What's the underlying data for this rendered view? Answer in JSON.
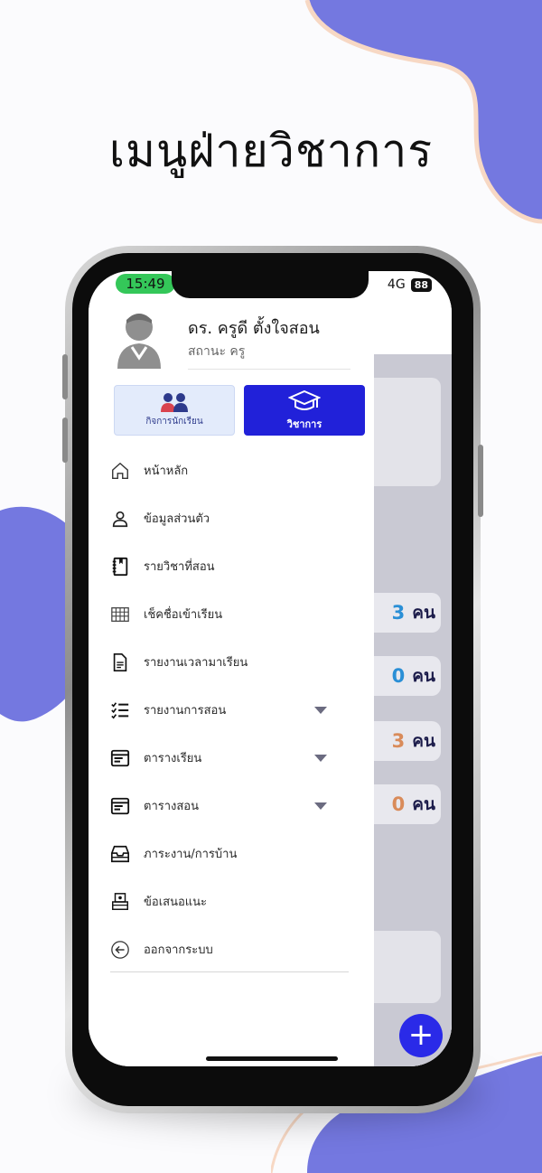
{
  "heading": "เมนูฝ่ายวิชาการ",
  "colors": {
    "accent_blob": "#7478e0",
    "primary": "#2121d9",
    "status_green": "#34c759"
  },
  "status_bar": {
    "time": "15:49",
    "network": "4G",
    "battery": "88"
  },
  "profile": {
    "name": "ดร. ครูดี ตั้งใจสอน",
    "status": "สถานะ ครู",
    "avatar_icon": "teacher-avatar-icon"
  },
  "modes": [
    {
      "label": "กิจการนักเรียน",
      "icon": "students-icon",
      "active": false
    },
    {
      "label": "วิชาการ",
      "icon": "graduation-cap-icon",
      "active": true
    }
  ],
  "menu": [
    {
      "label": "หน้าหลัก",
      "icon": "home-icon",
      "expandable": false
    },
    {
      "label": "ข้อมูลส่วนตัว",
      "icon": "user-icon",
      "expandable": false
    },
    {
      "label": "รายวิชาที่สอน",
      "icon": "notebook-icon",
      "expandable": false
    },
    {
      "label": "เช็คชื่อเข้าเรียน",
      "icon": "table-grid-icon",
      "expandable": false
    },
    {
      "label": "รายงานเวลามาเรียน",
      "icon": "document-icon",
      "expandable": false
    },
    {
      "label": "รายงานการสอน",
      "icon": "checklist-icon",
      "expandable": true
    },
    {
      "label": "ตารางเรียน",
      "icon": "schedule-icon",
      "expandable": true
    },
    {
      "label": "ตารางสอน",
      "icon": "schedule-icon",
      "expandable": true
    },
    {
      "label": "ภาระงาน/การบ้าน",
      "icon": "inbox-tray-icon",
      "expandable": false
    },
    {
      "label": "ข้อเสนอแนะ",
      "icon": "suggestion-box-icon",
      "expandable": false
    },
    {
      "label": "ออกจากระบบ",
      "icon": "logout-icon",
      "expandable": false
    }
  ],
  "background_stats": [
    {
      "value": "3",
      "unit": "คน",
      "color": "#2a8fd6"
    },
    {
      "value": "0",
      "unit": "คน",
      "color": "#2a8fd6"
    },
    {
      "value": "3",
      "unit": "คน",
      "color": "#d98b5a"
    },
    {
      "value": "0",
      "unit": "คน",
      "color": "#d98b5a"
    }
  ],
  "notifications": {
    "count": "0"
  },
  "fab": {
    "label": "+"
  }
}
